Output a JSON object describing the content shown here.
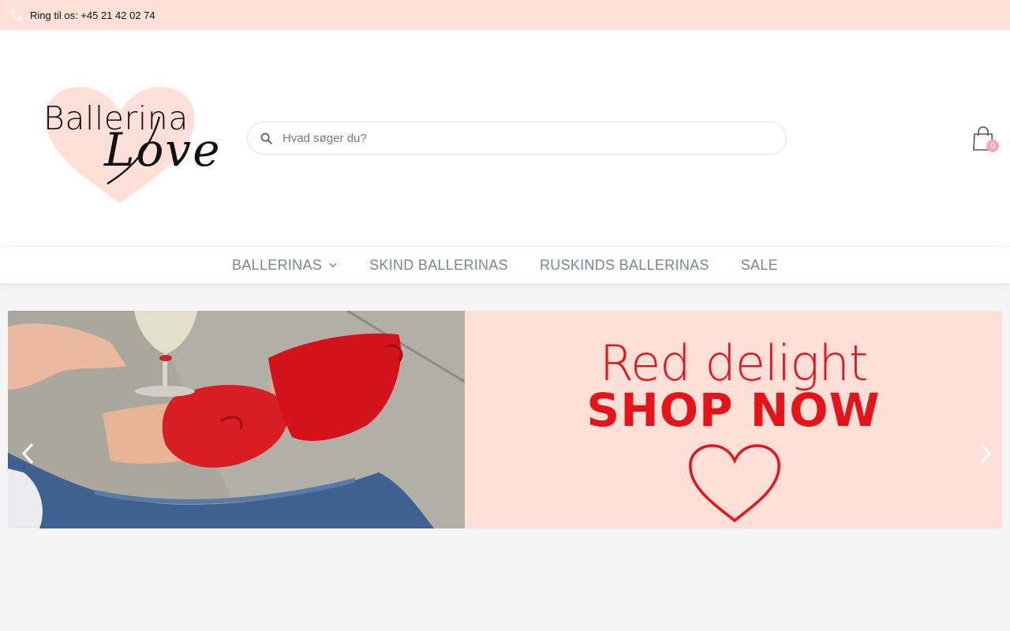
{
  "topbar": {
    "phone_icon": "phone-icon",
    "phone_text": "Ring til os: +45 21 42 02 74"
  },
  "header": {
    "logo": {
      "line1": "Ballerina",
      "line2": "Love"
    },
    "search": {
      "icon": "search-icon",
      "placeholder": "Hvad søger du?",
      "value": ""
    },
    "cart": {
      "icon": "shopping-bag-icon",
      "count": "0"
    }
  },
  "nav": {
    "items": [
      {
        "label": "BALLERINAS",
        "has_dropdown": true
      },
      {
        "label": "SKIND BALLERINAS"
      },
      {
        "label": "RUSKINDS BALLERINAS"
      },
      {
        "label": "SALE"
      }
    ]
  },
  "slider": {
    "promo_line1": "Red delight",
    "promo_line2": "SHOP NOW",
    "prev_icon": "chevron-left-icon",
    "next_icon": "chevron-right-icon"
  },
  "colors": {
    "accent_pink": "#ffe0d8",
    "promo_red": "#e4141a",
    "nav_text": "#7a8691",
    "badge": "#f0a8b8"
  }
}
